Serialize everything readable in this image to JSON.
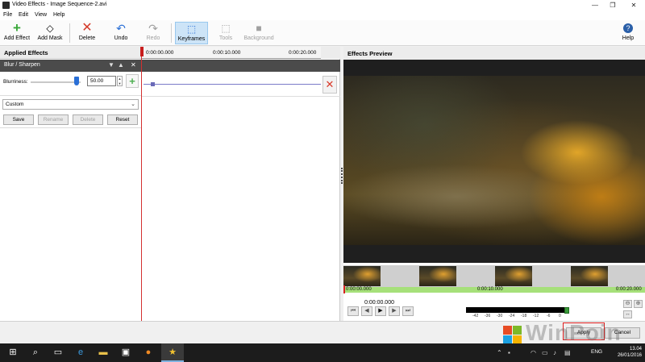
{
  "window": {
    "title": "Video Effects - Image Sequence-2.avi",
    "controls": [
      "—",
      "❐",
      "✕"
    ]
  },
  "menu": [
    "File",
    "Edit",
    "View",
    "Help"
  ],
  "toolbar": {
    "add_effect": "Add Effect",
    "add_mask": "Add Mask",
    "delete": "Delete",
    "undo": "Undo",
    "redo": "Redo",
    "keyframes": "Keyframes",
    "tools": "Tools",
    "background": "Background",
    "help": "Help"
  },
  "applied_effects": {
    "header": "Applied Effects",
    "ruler": [
      "0:00:00.000",
      "0:00:10.000",
      "0:00:20.000"
    ],
    "effect_name": "Blur / Sharpen",
    "param_label": "Blurriness:",
    "param_value": "50.00",
    "param_fraction": 0.92,
    "preset": "Custom",
    "buttons": {
      "save": "Save",
      "rename": "Rename",
      "delete": "Delete",
      "reset": "Reset"
    }
  },
  "preview": {
    "header": "Effects Preview",
    "timeline": [
      "0:00:00.000",
      "0:00:10.000",
      "0:00:20.000"
    ],
    "timecode": "0:00:00.000",
    "vu_scale": [
      "-42",
      "-36",
      "-30",
      "-24",
      "-18",
      "-12",
      "-6",
      "0"
    ]
  },
  "dialog": {
    "apply": "Apply",
    "cancel": "Cancel"
  },
  "watermark": "WinPoin",
  "colors": {
    "accent": "#2a6fd6",
    "playhead": "#d43030",
    "timeline_bar": "#a6e07a",
    "keyframe_line": "#7b7bc9"
  },
  "taskbar": {
    "lang": "ENG",
    "time": "13.04",
    "date": "26/01/2016"
  }
}
